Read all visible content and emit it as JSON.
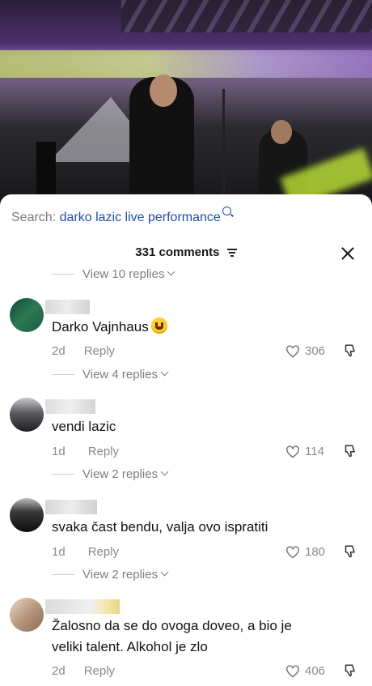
{
  "search": {
    "label": "Search:",
    "query": "darko lazic live performance"
  },
  "comments_header": {
    "count_label": "331 comments"
  },
  "top_thread": {
    "view_replies": "View 10 replies"
  },
  "comments": [
    {
      "text": "Darko Vajnhaus",
      "age": "2d",
      "reply": "Reply",
      "likes": "306",
      "view_replies": "View 4 replies"
    },
    {
      "text": "vendi lazic",
      "age": "1d",
      "reply": "Reply",
      "likes": "114",
      "view_replies": "View 2 replies"
    },
    {
      "text": "svaka čast bendu, valja ovo ispratiti",
      "age": "1d",
      "reply": "Reply",
      "likes": "180",
      "view_replies": "View 2 replies"
    },
    {
      "text": "Žalosno da se do ovoga doveo, a bio je veliki talent. Alkohol je zlo",
      "age": "2d",
      "reply": "Reply",
      "likes": "406"
    }
  ],
  "colors": {
    "search_query": "#1f4ea8",
    "muted": "#8a8a8a",
    "text": "#111111"
  }
}
